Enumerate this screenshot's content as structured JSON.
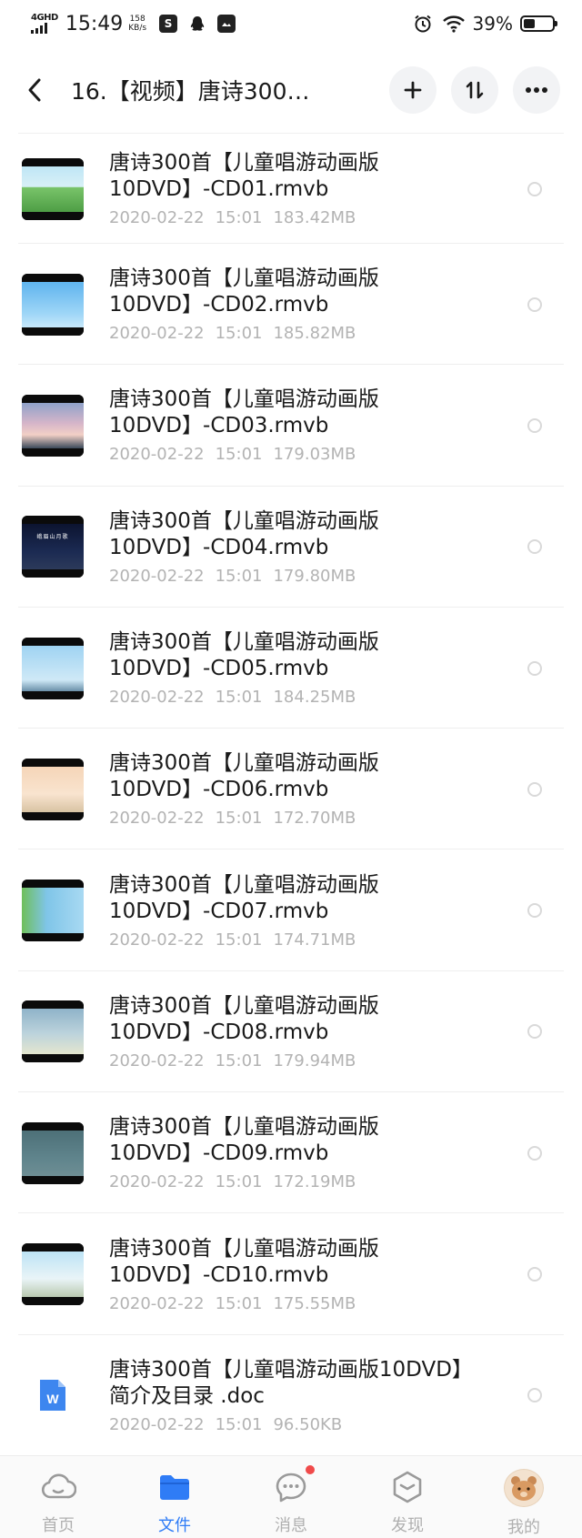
{
  "status_bar": {
    "network": "4GHD",
    "time": "15:49",
    "speed_value": "158",
    "speed_unit": "KB/s",
    "battery": "39%",
    "battery_level": 0.39
  },
  "header": {
    "title": "16.【视频】唐诗300…",
    "back_icon": "back-arrow-icon",
    "add_icon": "plus-icon",
    "sort_icon": "sort-icon",
    "more_icon": "more-icon"
  },
  "files": [
    {
      "name_line1": "唐诗300首【儿童唱游动画版",
      "name_line2": "10DVD】-CD01.rmvb",
      "date": "2020-02-22",
      "time": "15:01",
      "size": "183.42MB",
      "thumb": "green-field"
    },
    {
      "name_line1": "唐诗300首【儿童唱游动画版",
      "name_line2": "10DVD】-CD02.rmvb",
      "date": "2020-02-22",
      "time": "15:01",
      "size": "185.82MB",
      "thumb": "blue-sky"
    },
    {
      "name_line1": "唐诗300首【儿童唱游动画版",
      "name_line2": "10DVD】-CD03.rmvb",
      "date": "2020-02-22",
      "time": "15:01",
      "size": "179.03MB",
      "thumb": "dusk"
    },
    {
      "name_line1": "唐诗300首【儿童唱游动画版",
      "name_line2": "10DVD】-CD04.rmvb",
      "date": "2020-02-22",
      "time": "15:01",
      "size": "179.80MB",
      "thumb": "night",
      "thumb_text": "峨眉山月歌"
    },
    {
      "name_line1": "唐诗300首【儿童唱游动画版",
      "name_line2": "10DVD】-CD05.rmvb",
      "date": "2020-02-22",
      "time": "15:01",
      "size": "184.25MB",
      "thumb": "light-sky"
    },
    {
      "name_line1": "唐诗300首【儿童唱游动画版",
      "name_line2": "10DVD】-CD06.rmvb",
      "date": "2020-02-22",
      "time": "15:01",
      "size": "172.70MB",
      "thumb": "sunset"
    },
    {
      "name_line1": "唐诗300首【儿童唱游动画版",
      "name_line2": "10DVD】-CD07.rmvb",
      "date": "2020-02-22",
      "time": "15:01",
      "size": "174.71MB",
      "thumb": "tree"
    },
    {
      "name_line1": "唐诗300首【儿童唱游动画版",
      "name_line2": "10DVD】-CD08.rmvb",
      "date": "2020-02-22",
      "time": "15:01",
      "size": "179.94MB",
      "thumb": "hazy"
    },
    {
      "name_line1": "唐诗300首【儿童唱游动画版",
      "name_line2": "10DVD】-CD09.rmvb",
      "date": "2020-02-22",
      "time": "15:01",
      "size": "172.19MB",
      "thumb": "teal"
    },
    {
      "name_line1": "唐诗300首【儿童唱游动画版",
      "name_line2": "10DVD】-CD10.rmvb",
      "date": "2020-02-22",
      "time": "15:01",
      "size": "175.55MB",
      "thumb": "mountain"
    },
    {
      "name_line1": "唐诗300首【儿童唱游动画版10DVD】",
      "name_line2": "简介及目录 .doc",
      "date": "2020-02-22",
      "time": "15:01",
      "size": "96.50KB",
      "thumb": "doc",
      "thumb_text": "W"
    }
  ],
  "bottom_nav": [
    {
      "label": "首页",
      "icon": "cloud-icon",
      "active": false
    },
    {
      "label": "文件",
      "icon": "folder-icon",
      "active": true
    },
    {
      "label": "消息",
      "icon": "chat-icon",
      "active": false,
      "badge": true
    },
    {
      "label": "发现",
      "icon": "cube-icon",
      "active": false
    },
    {
      "label": "我的",
      "icon": "avatar-icon",
      "active": false
    }
  ],
  "colors": {
    "accent": "#2f7cf6",
    "meta_text": "#b3b3b3",
    "badge": "#f04a4a",
    "doc_icon": "#3d86ef"
  }
}
